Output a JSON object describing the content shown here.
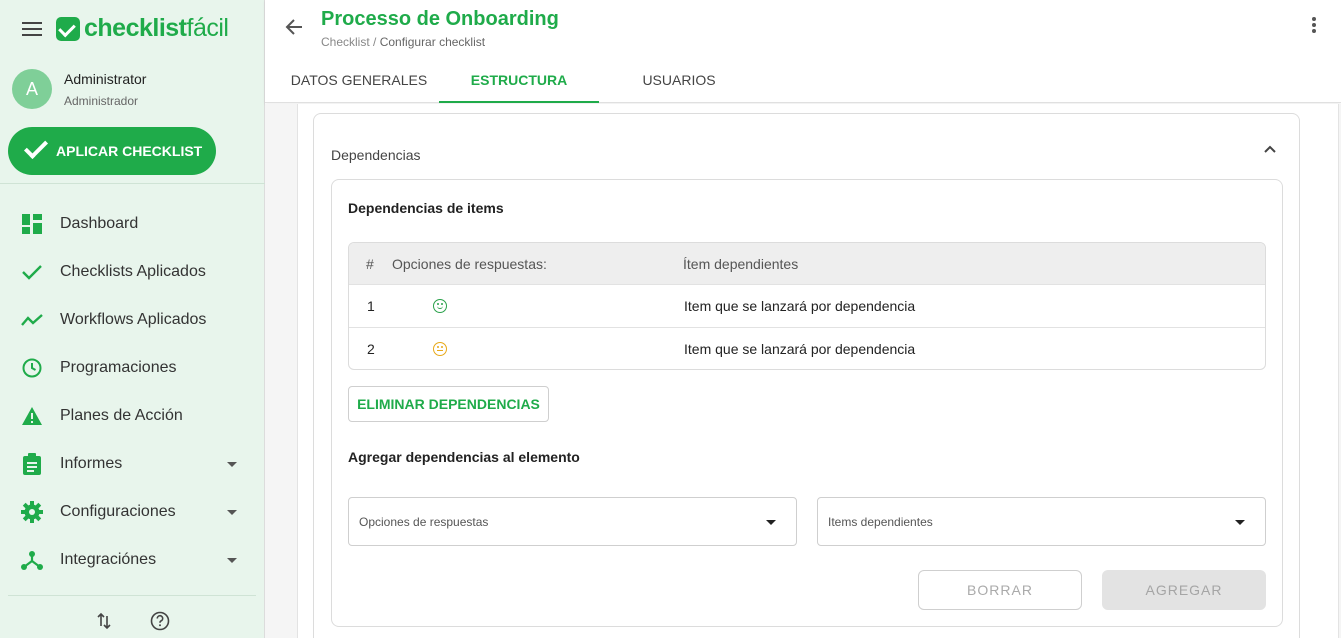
{
  "brand": {
    "logo_bold": "checklist",
    "logo_light": "fácil",
    "accent": "#1fab4a"
  },
  "user": {
    "initial": "A",
    "name": "Administrator",
    "role": "Administrador"
  },
  "sidebar": {
    "apply_label": "APLICAR CHECKLIST",
    "items": [
      {
        "label": "Dashboard",
        "icon": "dashboard-icon"
      },
      {
        "label": "Checklists Aplicados",
        "icon": "check-icon"
      },
      {
        "label": "Workflows Aplicados",
        "icon": "trend-icon"
      },
      {
        "label": "Programaciones",
        "icon": "clock-icon"
      },
      {
        "label": "Planes de Acción",
        "icon": "warning-icon"
      },
      {
        "label": "Informes",
        "icon": "clipboard-icon",
        "expandable": true
      },
      {
        "label": "Configuraciones",
        "icon": "gear-icon",
        "expandable": true
      },
      {
        "label": "Integraciónes",
        "icon": "integrations-icon",
        "expandable": true
      }
    ]
  },
  "header": {
    "title": "Processo de Onboarding",
    "breadcrumb_root": "Checklist",
    "breadcrumb_sep": " / ",
    "breadcrumb_current": "Configurar checklist",
    "tabs": [
      {
        "label": "DATOS GENERALES",
        "active": false
      },
      {
        "label": "ESTRUCTURA",
        "active": true
      },
      {
        "label": "USUARIOS",
        "active": false
      }
    ]
  },
  "panel": {
    "title": "Dependencias",
    "items_title": "Dependencias de items",
    "table": {
      "headers": [
        "#",
        "Opciones de respuestas:",
        "Ítem dependientes"
      ],
      "rows": [
        {
          "num": "1",
          "response_icon": "happy-face-icon",
          "dependent": "Item que se lanzará por dependencia"
        },
        {
          "num": "2",
          "response_icon": "neutral-face-icon",
          "dependent": "Item que se lanzará por dependencia"
        }
      ]
    },
    "delete_label": "ELIMINAR DEPENDENCIAS",
    "add_title": "Agregar dependencias al elemento",
    "select_responses_placeholder": "Opciones de respuestas",
    "select_items_placeholder": "Items dependientes",
    "clear_label": "BORRAR",
    "add_label": "AGREGAR"
  }
}
